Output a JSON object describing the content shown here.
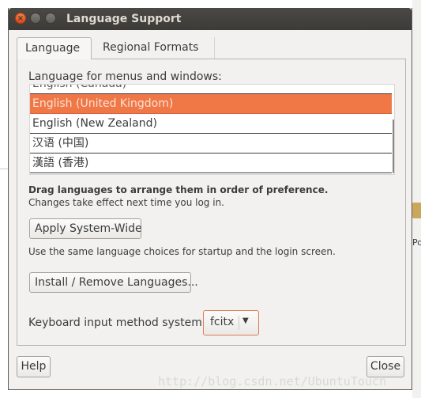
{
  "window": {
    "title": "Language Support",
    "close_glyph": "×"
  },
  "tabs": [
    {
      "label": "Language"
    },
    {
      "label": "Regional Formats"
    }
  ],
  "language_tab": {
    "menus_label": "Language for menus and windows:",
    "languages": [
      "English (Canada)",
      "English (United Kingdom)",
      "English (New Zealand)",
      "汉语 (中国)",
      "漢語 (香港)"
    ],
    "selected_index": 1,
    "drag_hint": "Drag languages to arrange them in order of preference.",
    "changes_hint": "Changes take effect next time you log in.",
    "apply_button": "Apply System-Wide",
    "same_choices_hint": "Use the same language choices for startup and the login screen.",
    "install_button": "Install / Remove Languages...",
    "keyboard_label": "Keyboard input method system:",
    "keyboard_value": "fcitx"
  },
  "footer": {
    "help_button": "Help",
    "close_button": "Close"
  },
  "background": {
    "fragment_text": "Po",
    "watermark": "http://blog.csdn.net/UbuntuTouch"
  },
  "colors": {
    "selection": "#f07746",
    "titlebar": "#3c3b37"
  }
}
